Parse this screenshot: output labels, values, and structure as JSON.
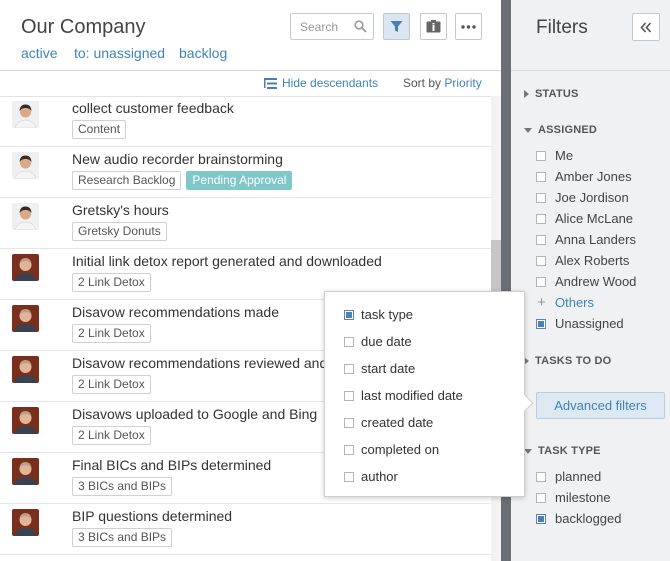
{
  "header": {
    "title": "Our Company",
    "filters": [
      "active",
      "to: unassigned",
      "backlog"
    ],
    "search_placeholder": "Search",
    "hide_descendants": "Hide descendants",
    "sort_by_label": "Sort by",
    "sort_by_value": "Priority"
  },
  "tasks": [
    {
      "title": "collect customer feedback",
      "avatar": "woman",
      "tags": [
        {
          "label": "Content",
          "style": "plain"
        }
      ]
    },
    {
      "title": "New audio recorder brainstorming",
      "avatar": "woman",
      "tags": [
        {
          "label": "Research Backlog",
          "style": "plain"
        },
        {
          "label": "Pending Approval",
          "style": "pending"
        }
      ]
    },
    {
      "title": "Gretsky's hours",
      "avatar": "woman",
      "tags": [
        {
          "label": "Gretsky Donuts",
          "style": "plain"
        }
      ]
    },
    {
      "title": "Initial link detox report generated and downloaded",
      "avatar": "man",
      "tags": [
        {
          "label": "2 Link Detox",
          "style": "plain"
        }
      ]
    },
    {
      "title": "Disavow recommendations made",
      "avatar": "man",
      "tags": [
        {
          "label": "2 Link Detox",
          "style": "plain"
        }
      ]
    },
    {
      "title": "Disavow recommendations reviewed and",
      "avatar": "man",
      "tags": [
        {
          "label": "2 Link Detox",
          "style": "plain"
        }
      ]
    },
    {
      "title": "Disavows uploaded to Google and Bing",
      "avatar": "man",
      "tags": [
        {
          "label": "2 Link Detox",
          "style": "plain"
        }
      ]
    },
    {
      "title": "Final BICs and BIPs determined",
      "avatar": "man",
      "tags": [
        {
          "label": "3 BICs and BIPs",
          "style": "plain"
        }
      ]
    },
    {
      "title": "BIP questions determined",
      "avatar": "man",
      "tags": [
        {
          "label": "3 BICs and BIPs",
          "style": "plain"
        }
      ]
    }
  ],
  "popover": {
    "items": [
      {
        "label": "task type",
        "checked": true
      },
      {
        "label": "due date",
        "checked": false
      },
      {
        "label": "start date",
        "checked": false
      },
      {
        "label": "last modified date",
        "checked": false
      },
      {
        "label": "created date",
        "checked": false
      },
      {
        "label": "completed on",
        "checked": false
      },
      {
        "label": "author",
        "checked": false
      }
    ]
  },
  "filters_panel": {
    "title": "Filters",
    "status": "STATUS",
    "assigned": "ASSIGNED",
    "assigned_options": [
      {
        "label": "Me",
        "checked": false
      },
      {
        "label": "Amber Jones",
        "checked": false
      },
      {
        "label": "Joe Jordison",
        "checked": false
      },
      {
        "label": "Alice McLane",
        "checked": false
      },
      {
        "label": "Anna Landers",
        "checked": false
      },
      {
        "label": "Alex Roberts",
        "checked": false
      },
      {
        "label": "Andrew Wood",
        "checked": false
      }
    ],
    "others": "Others",
    "unassigned": {
      "label": "Unassigned",
      "checked": true
    },
    "tasks_to_do": "TASKS TO DO",
    "advanced": "Advanced filters",
    "task_type": "TASK TYPE",
    "task_type_options": [
      {
        "label": "planned",
        "checked": false
      },
      {
        "label": "milestone",
        "checked": false
      },
      {
        "label": "backlogged",
        "checked": true
      }
    ]
  },
  "colors": {
    "accent": "#3d84b8",
    "divider": "#6b6e73",
    "pending_tag": "#7fc8c8",
    "checked_box": "#4e7fb0"
  }
}
